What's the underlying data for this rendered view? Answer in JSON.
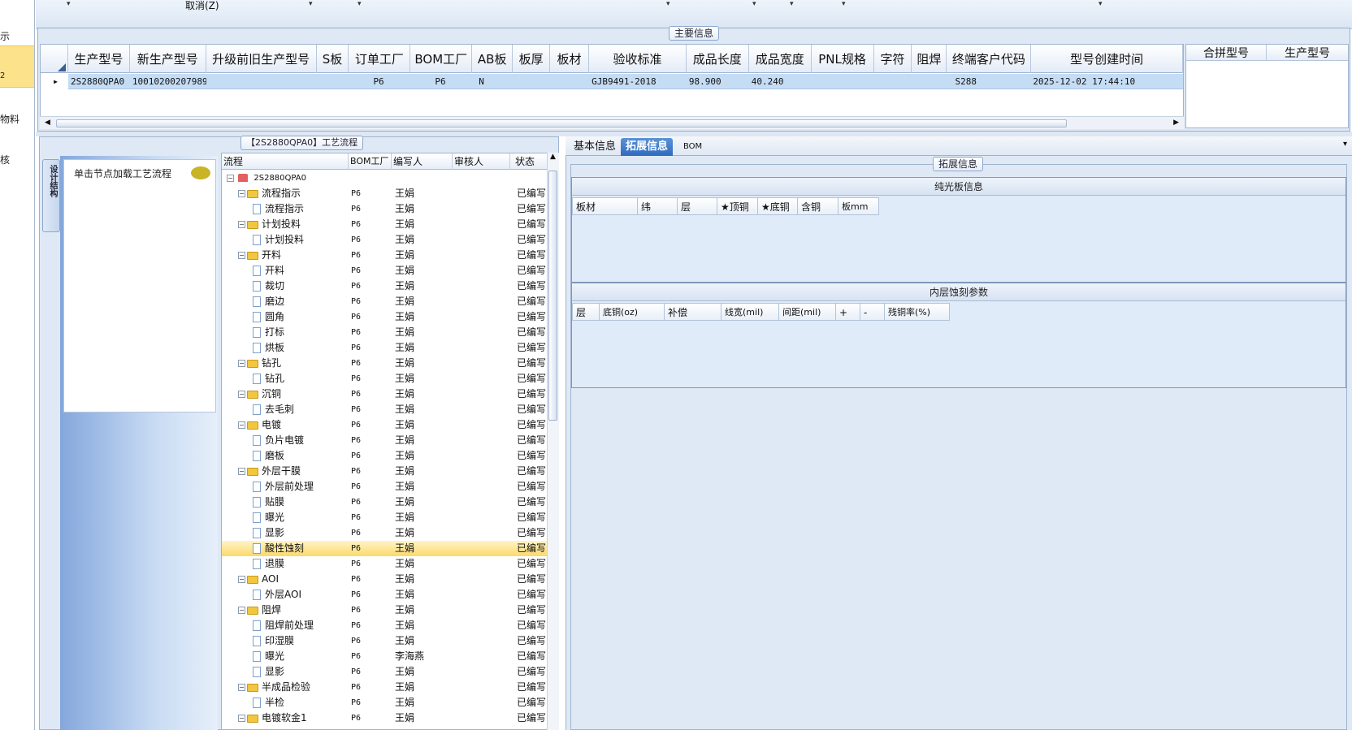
{
  "left_nav": {
    "items": [
      "示",
      "2",
      "物料",
      "核"
    ]
  },
  "toolbar": {
    "cancel_label": "取消(Z)",
    "dropdown_glyph": "▾"
  },
  "main_info": {
    "title": "主要信息",
    "columns": [
      "生产型号",
      "新生产型号",
      "升级前旧生产型号",
      "S板",
      "订单工厂",
      "BOM工厂",
      "AB板",
      "板厚",
      "板材",
      "验收标准",
      "成品长度",
      "成品宽度",
      "PNL规格",
      "字符",
      "阻焊",
      "终端客户代码",
      "型号创建时间"
    ],
    "row": [
      "2S2880QPA0",
      "10010200207989",
      "",
      "",
      "P6",
      "P6",
      "N",
      "",
      "",
      "GJB9491-2018",
      "98.900",
      "40.240",
      "",
      "",
      "",
      "S288",
      "2025-12-02 17:44:10"
    ],
    "right_columns": [
      "合拼型号",
      "生产型号"
    ]
  },
  "process": {
    "title": "【2S2880QPA0】工艺流程",
    "side_tab": "设计结构",
    "node_hint": "单击节点加载工艺流程",
    "headers": [
      "流程",
      "BOM工厂",
      "编写人",
      "审核人",
      "状态"
    ],
    "root": "2S2880QPA0",
    "rows": [
      {
        "name": "流程指示",
        "level": 1,
        "bom": "P6",
        "writer": "王娟",
        "status": "已编写"
      },
      {
        "name": "流程指示",
        "level": 2,
        "bom": "P6",
        "writer": "王娟",
        "status": "已编写"
      },
      {
        "name": "计划投料",
        "level": 1,
        "bom": "P6",
        "writer": "王娟",
        "status": "已编写"
      },
      {
        "name": "计划投料",
        "level": 2,
        "bom": "P6",
        "writer": "王娟",
        "status": "已编写"
      },
      {
        "name": "开料",
        "level": 1,
        "bom": "P6",
        "writer": "王娟",
        "status": "已编写"
      },
      {
        "name": "开料",
        "level": 2,
        "bom": "P6",
        "writer": "王娟",
        "status": "已编写"
      },
      {
        "name": "裁切",
        "level": 2,
        "bom": "P6",
        "writer": "王娟",
        "status": "已编写"
      },
      {
        "name": "磨边",
        "level": 2,
        "bom": "P6",
        "writer": "王娟",
        "status": "已编写"
      },
      {
        "name": "圆角",
        "level": 2,
        "bom": "P6",
        "writer": "王娟",
        "status": "已编写"
      },
      {
        "name": "打标",
        "level": 2,
        "bom": "P6",
        "writer": "王娟",
        "status": "已编写"
      },
      {
        "name": "烘板",
        "level": 2,
        "bom": "P6",
        "writer": "王娟",
        "status": "已编写"
      },
      {
        "name": "钻孔",
        "level": 1,
        "bom": "P6",
        "writer": "王娟",
        "status": "已编写"
      },
      {
        "name": "钻孔",
        "level": 2,
        "bom": "P6",
        "writer": "王娟",
        "status": "已编写"
      },
      {
        "name": "沉铜",
        "level": 1,
        "bom": "P6",
        "writer": "王娟",
        "status": "已编写"
      },
      {
        "name": "去毛刺",
        "level": 2,
        "bom": "P6",
        "writer": "王娟",
        "status": "已编写"
      },
      {
        "name": "电镀",
        "level": 1,
        "bom": "P6",
        "writer": "王娟",
        "status": "已编写"
      },
      {
        "name": "负片电镀",
        "level": 2,
        "bom": "P6",
        "writer": "王娟",
        "status": "已编写"
      },
      {
        "name": "磨板",
        "level": 2,
        "bom": "P6",
        "writer": "王娟",
        "status": "已编写"
      },
      {
        "name": "外层干膜",
        "level": 1,
        "bom": "P6",
        "writer": "王娟",
        "status": "已编写"
      },
      {
        "name": "外层前处理",
        "level": 2,
        "bom": "P6",
        "writer": "王娟",
        "status": "已编写"
      },
      {
        "name": "贴膜",
        "level": 2,
        "bom": "P6",
        "writer": "王娟",
        "status": "已编写"
      },
      {
        "name": "曝光",
        "level": 2,
        "bom": "P6",
        "writer": "王娟",
        "status": "已编写"
      },
      {
        "name": "显影",
        "level": 2,
        "bom": "P6",
        "writer": "王娟",
        "status": "已编写"
      },
      {
        "name": "酸性蚀刻",
        "level": 2,
        "bom": "P6",
        "writer": "王娟",
        "status": "已编写",
        "selected": true
      },
      {
        "name": "退膜",
        "level": 2,
        "bom": "P6",
        "writer": "王娟",
        "status": "已编写"
      },
      {
        "name": "AOI",
        "level": 1,
        "bom": "P6",
        "writer": "王娟",
        "status": "已编写"
      },
      {
        "name": "外层AOI",
        "level": 2,
        "bom": "P6",
        "writer": "王娟",
        "status": "已编写"
      },
      {
        "name": "阻焊",
        "level": 1,
        "bom": "P6",
        "writer": "王娟",
        "status": "已编写"
      },
      {
        "name": "阻焊前处理",
        "level": 2,
        "bom": "P6",
        "writer": "王娟",
        "status": "已编写"
      },
      {
        "name": "印湿膜",
        "level": 2,
        "bom": "P6",
        "writer": "王娟",
        "status": "已编写"
      },
      {
        "name": "曝光",
        "level": 2,
        "bom": "P6",
        "writer": "李海燕",
        "status": "已编写"
      },
      {
        "name": "显影",
        "level": 2,
        "bom": "P6",
        "writer": "王娟",
        "status": "已编写"
      },
      {
        "name": "半成品检验",
        "level": 1,
        "bom": "P6",
        "writer": "王娟",
        "status": "已编写"
      },
      {
        "name": "半检",
        "level": 2,
        "bom": "P6",
        "writer": "王娟",
        "status": "已编写"
      },
      {
        "name": "电镀软金1",
        "level": 1,
        "bom": "P6",
        "writer": "王娟",
        "status": "已编写"
      }
    ]
  },
  "right": {
    "tabs": [
      "基本信息",
      "拓展信息",
      "BOM"
    ],
    "active_tab": 1,
    "ext_title": "拓展信息",
    "section1": {
      "title": "纯光板信息",
      "columns": [
        "板材",
        "纬",
        "层",
        "★顶铜",
        "★底铜",
        "含铜",
        "板mm"
      ]
    },
    "section2": {
      "title": "内层蚀刻参数",
      "columns": [
        "层",
        "底铜(oz)",
        "补偿",
        "线宽(mil)",
        "间距(mil)",
        "+",
        "-",
        "残铜率(%)"
      ]
    }
  }
}
